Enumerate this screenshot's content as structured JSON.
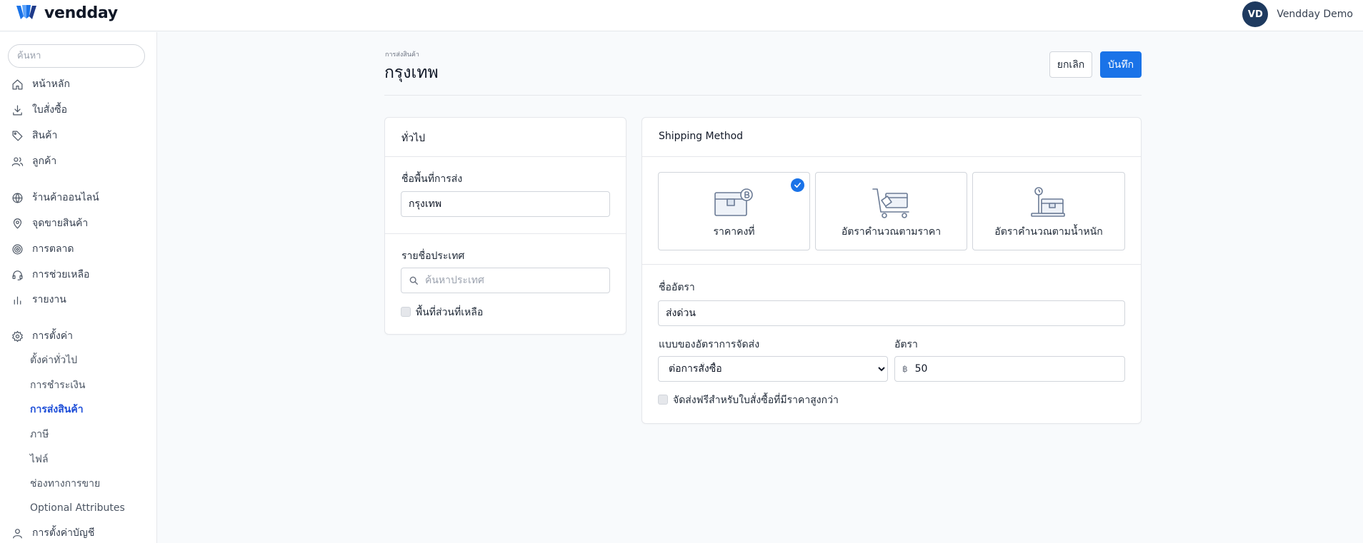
{
  "app": {
    "name": "vendday"
  },
  "user": {
    "initials": "VD",
    "name": "Vendday Demo"
  },
  "sidebar": {
    "search_placeholder": "ค้นหา",
    "items": [
      {
        "label": "หน้าหลัก",
        "icon": "home-icon"
      },
      {
        "label": "ใบสั่งซื้อ",
        "icon": "download-icon"
      },
      {
        "label": "สินค้า",
        "icon": "tag-icon"
      },
      {
        "label": "ลูกค้า",
        "icon": "users-icon"
      },
      {
        "label": "ร้านค้าออนไลน์",
        "icon": "globe-icon"
      },
      {
        "label": "จุดขายสินค้า",
        "icon": "map-pin-icon"
      },
      {
        "label": "การตลาด",
        "icon": "target-icon"
      },
      {
        "label": "การช่วยเหลือ",
        "icon": "headset-icon"
      },
      {
        "label": "รายงาน",
        "icon": "bar-chart-icon"
      },
      {
        "label": "การตั้งค่า",
        "icon": "gear-icon"
      }
    ],
    "settings_sub": [
      {
        "label": "ตั้งค่าทั่วไป"
      },
      {
        "label": "การชำระเงิน"
      },
      {
        "label": "การส่งสินค้า"
      },
      {
        "label": "ภาษี"
      },
      {
        "label": "ไฟล์"
      },
      {
        "label": "ช่องทางการขาย"
      },
      {
        "label": "Optional Attributes"
      }
    ],
    "account_settings": {
      "label": "การตั้งค่าบัญชี",
      "icon": "user-icon"
    }
  },
  "header": {
    "breadcrumb": "การส่งสินค้า",
    "title": "กรุงเทพ",
    "cancel_label": "ยกเลิก",
    "save_label": "บันทึก"
  },
  "general": {
    "title": "ทั่วไป",
    "zone_name_label": "ชื่อพื้นที่การส่ง",
    "zone_name_value": "กรุงเทพ",
    "countries_label": "รายชื่อประเทศ",
    "country_search_placeholder": "ค้นหาประเทศ",
    "rest_of_world_label": "พื้นที่ส่วนที่เหลือ"
  },
  "shipping": {
    "title": "Shipping Method",
    "methods": [
      {
        "label": "ราคาคงที่",
        "icon": "box-coin-icon",
        "selected": true
      },
      {
        "label": "อัตราคำนวณตามราคา",
        "icon": "cart-box-icon",
        "selected": false
      },
      {
        "label": "อัตราคำนวณตามน้ำหนัก",
        "icon": "scale-box-icon",
        "selected": false
      }
    ],
    "rate_name_label": "ชื่ออัตรา",
    "rate_name_value": "ส่งด่วน",
    "rate_type_label": "แบบของอัตราการจัดส่ง",
    "rate_type_value": "ต่อการสั่งซื้อ",
    "rate_label": "อัตรา",
    "currency_symbol": "฿",
    "rate_value": "50",
    "free_shipping_label": "จัดส่งฟรีสำหรับใบสั่งซื้อที่มีราคาสูงกว่า"
  },
  "colors": {
    "primary": "#1a73e8",
    "active_nav": "#1d4ed8",
    "avatar": "#1e3a5f"
  }
}
